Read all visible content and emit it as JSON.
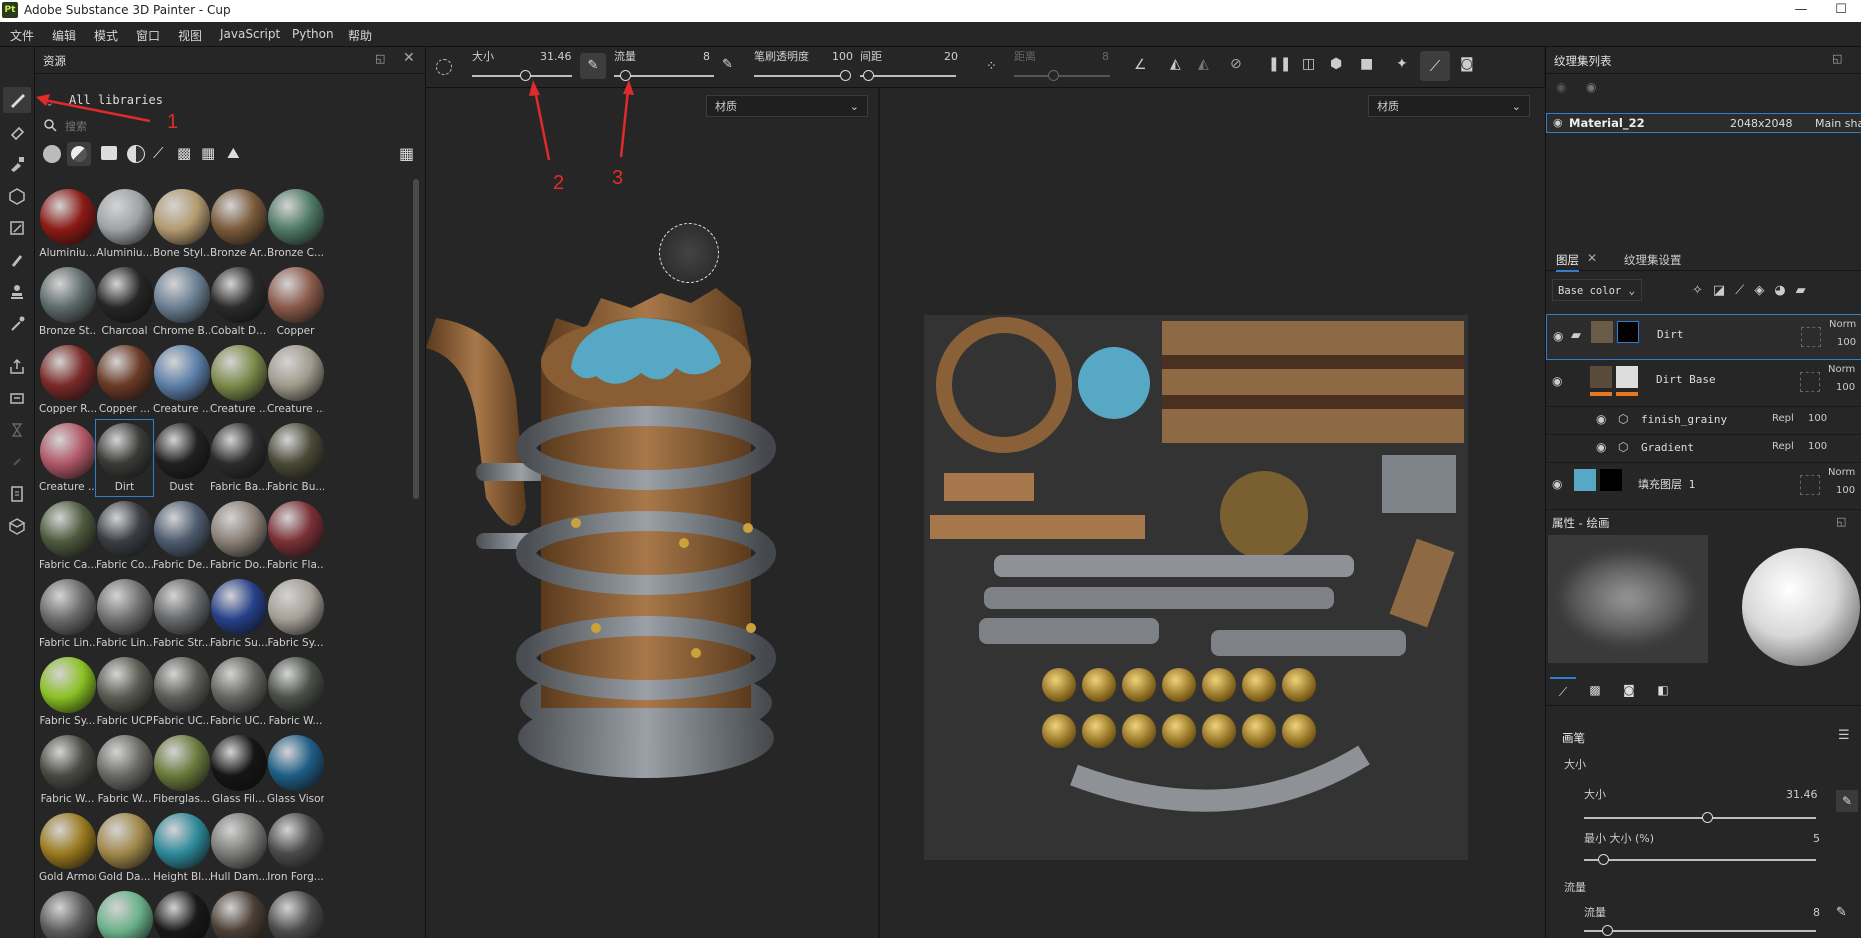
{
  "window": {
    "title": "Adobe Substance 3D Painter - Cup",
    "app_icon": "Pt"
  },
  "menu": [
    "文件",
    "编辑",
    "模式",
    "窗口",
    "视图",
    "JavaScript",
    "Python",
    "帮助"
  ],
  "assets": {
    "title": "资源",
    "library": "All libraries",
    "search_placeholder": "搜索",
    "items": [
      {
        "label": "Aluminiu...",
        "color": "#8c1a14"
      },
      {
        "label": "Aluminiu...",
        "color": "#9fa2a6"
      },
      {
        "label": "Bone Styl...",
        "color": "#b39a70"
      },
      {
        "label": "Bronze Ar...",
        "color": "#7a5a3a"
      },
      {
        "label": "Bronze C...",
        "color": "#4f7a66"
      },
      {
        "label": "Bronze St...",
        "color": "#5e6b6b"
      },
      {
        "label": "Charcoal",
        "color": "#262626"
      },
      {
        "label": "Chrome B...",
        "color": "#6a7f92"
      },
      {
        "label": "Cobalt D...",
        "color": "#2a2a2a"
      },
      {
        "label": "Copper",
        "color": "#8a5a4a"
      },
      {
        "label": "Copper R...",
        "color": "#7a2a28"
      },
      {
        "label": "Copper ...",
        "color": "#6a3a26"
      },
      {
        "label": "Creature ...",
        "color": "#5c7fa8"
      },
      {
        "label": "Creature ...",
        "color": "#7c8a4a"
      },
      {
        "label": "Creature ...",
        "color": "#a09a8c"
      },
      {
        "label": "Creature ...",
        "color": "#b05868"
      },
      {
        "label": "Dirt",
        "color": "#3a3a38"
      },
      {
        "label": "Dust",
        "color": "#202020"
      },
      {
        "label": "Fabric Ba...",
        "color": "#2c2c2c"
      },
      {
        "label": "Fabric Bu...",
        "color": "#4a4a38"
      },
      {
        "label": "Fabric Ca...",
        "color": "#4e5a3e"
      },
      {
        "label": "Fabric Co...",
        "color": "#3a3e44"
      },
      {
        "label": "Fabric De...",
        "color": "#4e5c70"
      },
      {
        "label": "Fabric Do...",
        "color": "#8a8076"
      },
      {
        "label": "Fabric Fla...",
        "color": "#7a3036"
      },
      {
        "label": "Fabric Lin...",
        "color": "#6a6a6a"
      },
      {
        "label": "Fabric Lin...",
        "color": "#707070"
      },
      {
        "label": "Fabric Str...",
        "color": "#66686a"
      },
      {
        "label": "Fabric Su...",
        "color": "#26408a"
      },
      {
        "label": "Fabric Sy...",
        "color": "#a49e96"
      },
      {
        "label": "Fabric Sy...",
        "color": "#8ac024"
      },
      {
        "label": "Fabric UCP",
        "color": "#5a5a52"
      },
      {
        "label": "Fabric UC...",
        "color": "#5c5c58"
      },
      {
        "label": "Fabric UC...",
        "color": "#646460"
      },
      {
        "label": "Fabric W...",
        "color": "#4a5048"
      },
      {
        "label": "Fabric W...",
        "color": "#4a4a44"
      },
      {
        "label": "Fabric W...",
        "color": "#6a6a66"
      },
      {
        "label": "Fiberglas...",
        "color": "#6a7a3c"
      },
      {
        "label": "Glass Fil...",
        "color": "#151515"
      },
      {
        "label": "Glass Visor",
        "color": "#1e5e86"
      },
      {
        "label": "Gold Armor",
        "color": "#9a7a1e"
      },
      {
        "label": "Gold Da...",
        "color": "#a0884a"
      },
      {
        "label": "Height Bl...",
        "color": "#2e8a9a"
      },
      {
        "label": "Hull Dam...",
        "color": "#7a7a78"
      },
      {
        "label": "Iron Forg...",
        "color": "#4a4a4a"
      },
      {
        "label": "",
        "color": "#5a5a5a"
      },
      {
        "label": "",
        "color": "#6ab08a"
      },
      {
        "label": "",
        "color": "#181818"
      },
      {
        "label": "",
        "color": "#4a3e34"
      },
      {
        "label": "",
        "color": "#4a4a4a"
      }
    ]
  },
  "brush_bar": {
    "size_label": "大小",
    "size_value": "31.46",
    "flow_label": "流量",
    "flow_value": "8",
    "opacity_label": "笔刷透明度",
    "opacity_value": "100",
    "spacing_label": "间距",
    "spacing_value": "20",
    "distance_label": "距离",
    "distance_value": "8"
  },
  "viewport": {
    "left_dropdown": "材质",
    "right_dropdown": "材质"
  },
  "annotations": [
    "1",
    "2",
    "3"
  ],
  "texture_set": {
    "title": "纹理集列表",
    "material": "Material_22",
    "resolution": "2048x2048",
    "shader": "Main shad"
  },
  "layers": {
    "tab_layers": "图层",
    "tab_settings": "纹理集设置",
    "channel": "Base color",
    "items": [
      {
        "name": "Dirt",
        "blend": "Norm",
        "opacity": "100"
      },
      {
        "name": "Dirt Base",
        "blend": "Norm",
        "opacity": "100"
      },
      {
        "name": "finish_grainy",
        "blend": "Repl",
        "opacity": "100"
      },
      {
        "name": "Gradient",
        "blend": "Repl",
        "opacity": "100"
      },
      {
        "name": "填充图层 1",
        "blend": "Norm",
        "opacity": "100"
      }
    ]
  },
  "properties": {
    "title": "属性 - 绘画",
    "brush_section": "画笔",
    "size_group": "大小",
    "size_label": "大小",
    "size_value": "31.46",
    "size_fraction": 0.53,
    "min_size_label": "最小 大小 (%)",
    "min_size_value": "5",
    "flow_group": "流量",
    "flow_label": "流量",
    "flow_value": "8"
  },
  "colors": {
    "accent_blue": "#2f7fcf",
    "annotation_red": "#e02b2b",
    "highlight_orange": "#e87722"
  }
}
